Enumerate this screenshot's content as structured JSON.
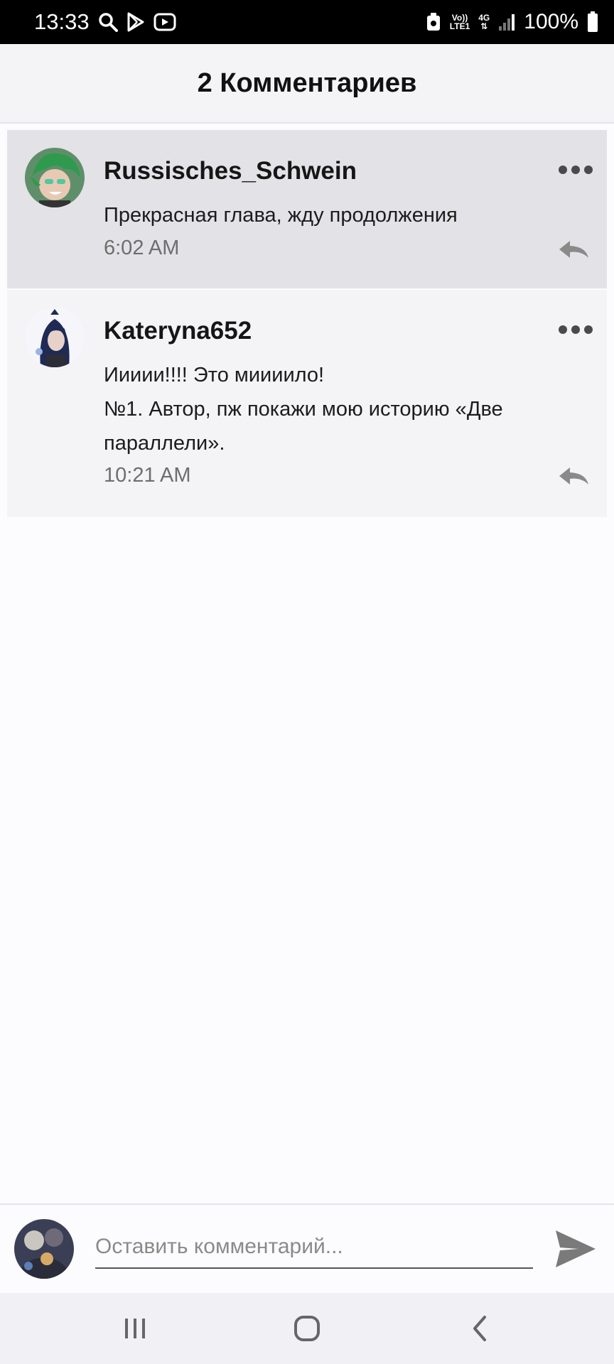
{
  "status_bar": {
    "time": "13:33",
    "left_icons": [
      "search-icon",
      "play-store-icon",
      "youtube-icon"
    ],
    "right_icons": [
      "eco-icon",
      "volte-icon",
      "4g-icon",
      "signal-icon",
      "battery-icon"
    ],
    "volte_label_top": "Vo))",
    "volte_label_bottom": "LTE1",
    "network_label": "4G",
    "battery_text": "100%"
  },
  "header": {
    "title": "2 Комментариев"
  },
  "comments": [
    {
      "username": "Russisches_Schwein",
      "text_lines": [
        "Прекрасная глава, жду продолжения"
      ],
      "time": "6:02 AM",
      "avatar_icon": "green-hair-avatar",
      "highlighted": true
    },
    {
      "username": "Kateryna652",
      "text_lines": [
        "Иииии!!!! Это миииило!",
        "№1. Автор, пж покажи мою историю «Две",
        "параллели»."
      ],
      "time": "10:21 AM",
      "avatar_icon": "dark-hair-avatar",
      "highlighted": false
    }
  ],
  "input": {
    "placeholder": "Оставить комментарий...",
    "value": ""
  },
  "nav": {
    "buttons": [
      "recent-apps-icon",
      "home-icon",
      "back-icon"
    ]
  },
  "colors": {
    "highlight_bg": "#e3e2e6",
    "comment_bg": "#f4f3f6",
    "page_bg": "#fcfbfd",
    "icon_gray": "#8a8a8a"
  }
}
